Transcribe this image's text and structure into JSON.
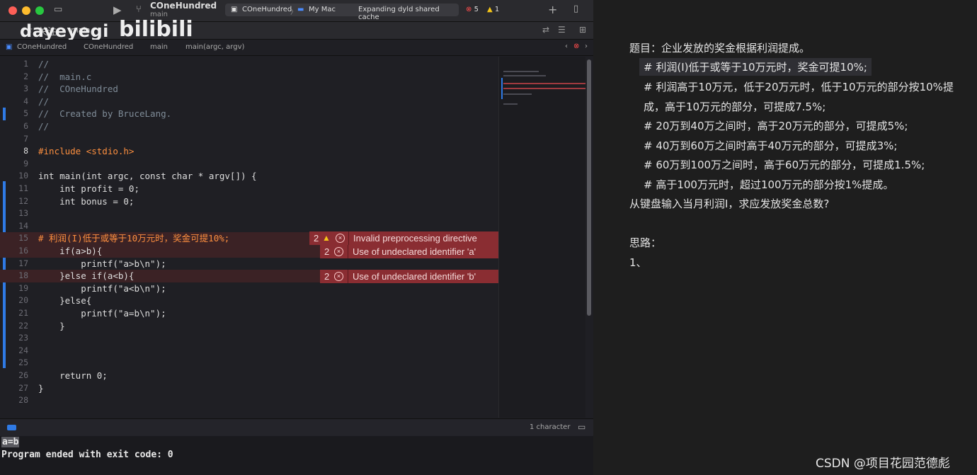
{
  "titlebar": {
    "project": "COneHundred",
    "branch": "main",
    "scheme_target": "COneHundred",
    "destination": "My Mac",
    "activity": "Expanding dyld shared cache",
    "error_count": "5",
    "warning_count": "1"
  },
  "watermark": {
    "user": "dayeyegi",
    "site": "bilibili"
  },
  "tab": {
    "follow": "关注",
    "label": "main"
  },
  "jumpbar": {
    "items": [
      "COneHundred",
      "COneHundred",
      "main",
      "main(argc, argv)"
    ]
  },
  "editor": {
    "lines": [
      {
        "n": "1",
        "text": "//"
      },
      {
        "n": "2",
        "text": "//  main.c"
      },
      {
        "n": "3",
        "text": "//  COneHundred"
      },
      {
        "n": "4",
        "text": "//"
      },
      {
        "n": "5",
        "text": "//  Created by BruceLang."
      },
      {
        "n": "6",
        "text": "//"
      },
      {
        "n": "7",
        "text": ""
      },
      {
        "n": "8",
        "text": "#include <stdio.h>"
      },
      {
        "n": "9",
        "text": ""
      },
      {
        "n": "10",
        "text": "int main(int argc, const char * argv[]) {"
      },
      {
        "n": "11",
        "text": "    int profit = 0;"
      },
      {
        "n": "12",
        "text": "    int bonus = 0;"
      },
      {
        "n": "13",
        "text": ""
      },
      {
        "n": "14",
        "text": ""
      },
      {
        "n": "15",
        "text": "# 利润(I)低于或等于10万元时，奖金可提10%;"
      },
      {
        "n": "16",
        "text": "    if(a>b){"
      },
      {
        "n": "17",
        "text": "        printf(\"a>b\\n\");"
      },
      {
        "n": "18",
        "text": "    }else if(a<b){"
      },
      {
        "n": "19",
        "text": "        printf(\"a<b\\n\");"
      },
      {
        "n": "20",
        "text": "    }else{"
      },
      {
        "n": "21",
        "text": "        printf(\"a=b\\n\");"
      },
      {
        "n": "22",
        "text": "    }"
      },
      {
        "n": "23",
        "text": ""
      },
      {
        "n": "24",
        "text": ""
      },
      {
        "n": "25",
        "text": ""
      },
      {
        "n": "26",
        "text": "    return 0;"
      },
      {
        "n": "27",
        "text": "}"
      },
      {
        "n": "28",
        "text": ""
      }
    ],
    "issues": [
      {
        "count": "2",
        "kind": "warning",
        "message": "Invalid preprocessing directive"
      },
      {
        "count": "2",
        "kind": "error",
        "message": "Use of undeclared identifier 'a'"
      },
      {
        "count": "2",
        "kind": "error",
        "message": "Use of undeclared identifier 'b'"
      }
    ]
  },
  "status": {
    "selection": "1 character"
  },
  "console": {
    "lines": [
      "a=b",
      "Program ended with exit code: 0"
    ]
  },
  "notes": {
    "title": "题目：企业发放的奖金根据利润提成。",
    "rules": [
      "# 利润(I)低于或等于10万元时，奖金可提10%;",
      "# 利润高于10万元，低于20万元时，低于10万元的部分按10%提",
      "成，高于10万元的部分，可提成7.5%;",
      "# 20万到40万之间时，高于20万元的部分，可提成5%;",
      "# 40万到60万之间时高于40万元的部分，可提成3%;",
      "# 60万到100万之间时，高于60万元的部分，可提成1.5%;",
      "# 高于100万元时，超过100万元的部分按1%提成。"
    ],
    "question": "从键盘输入当月利润I，求应发放奖金总数?",
    "thinking": "思路：",
    "step1": "1、"
  },
  "footer": {
    "credit": "CSDN @项目花园范德彪"
  },
  "colors": {
    "accent": "#2f7ae5",
    "error_bg": "#8a2d32",
    "keyword": "#fc5fa3"
  }
}
